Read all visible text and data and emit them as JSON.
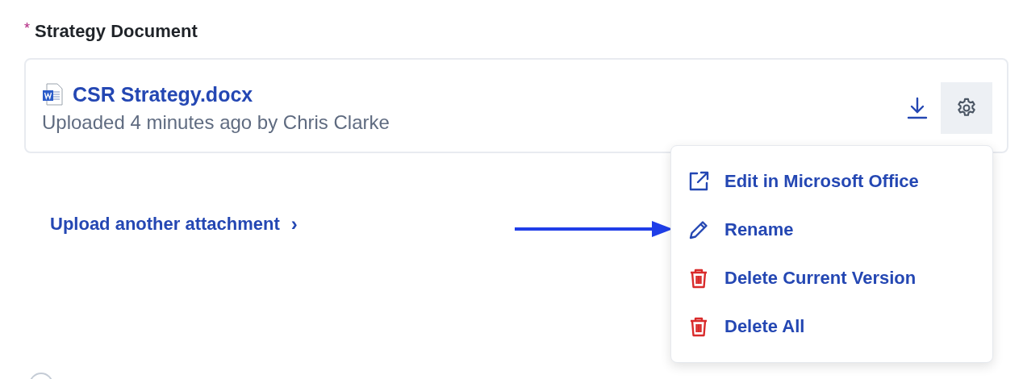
{
  "field": {
    "label": "Strategy Document",
    "required_mark": "*"
  },
  "attachment": {
    "file_name": "CSR Strategy.docx",
    "meta": "Uploaded 4 minutes ago by Chris Clarke"
  },
  "settings_button": {
    "expanded": true
  },
  "menu": [
    {
      "kind": "external",
      "label": "Edit in Microsoft Office"
    },
    {
      "kind": "edit",
      "label": "Rename"
    },
    {
      "kind": "delete",
      "label": "Delete Current Version"
    },
    {
      "kind": "delete",
      "label": "Delete All"
    }
  ],
  "upload_link": {
    "label": "Upload another attachment",
    "icon": "›"
  }
}
